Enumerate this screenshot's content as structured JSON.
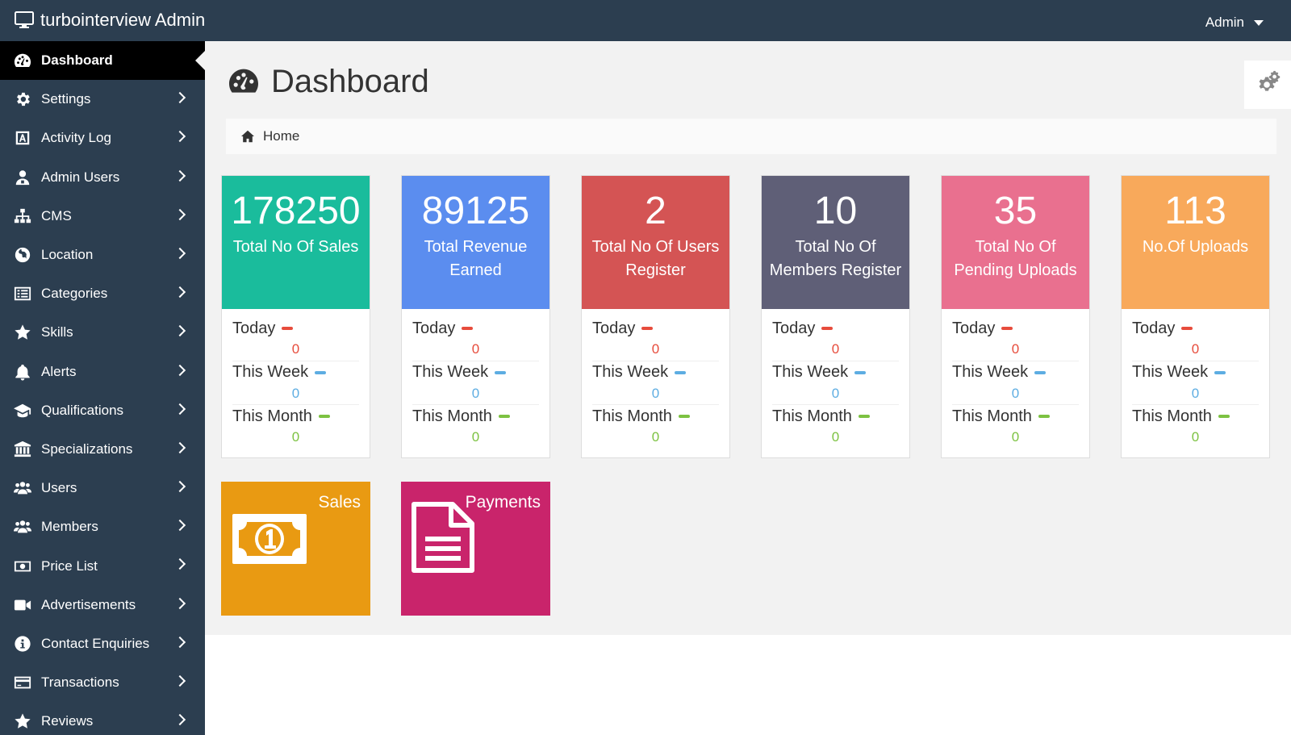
{
  "app": {
    "brand": "turbointerview Admin",
    "user": "Admin"
  },
  "sidebar": {
    "items": [
      {
        "label": "Dashboard",
        "icon": "dashboard-icon",
        "active": true
      },
      {
        "label": "Settings",
        "icon": "gear-icon"
      },
      {
        "label": "Activity Log",
        "icon": "activity-log-icon"
      },
      {
        "label": "Admin Users",
        "icon": "admin-user-icon"
      },
      {
        "label": "CMS",
        "icon": "sitemap-icon"
      },
      {
        "label": "Location",
        "icon": "globe-icon"
      },
      {
        "label": "Categories",
        "icon": "list-icon"
      },
      {
        "label": "Skills",
        "icon": "star-icon"
      },
      {
        "label": "Alerts",
        "icon": "bell-icon"
      },
      {
        "label": "Qualifications",
        "icon": "graduation-cap-icon"
      },
      {
        "label": "Specializations",
        "icon": "bank-icon"
      },
      {
        "label": "Users",
        "icon": "users-icon"
      },
      {
        "label": "Members",
        "icon": "users-icon"
      },
      {
        "label": "Price List",
        "icon": "money-icon"
      },
      {
        "label": "Advertisements",
        "icon": "video-camera-icon"
      },
      {
        "label": "Contact Enquiries",
        "icon": "info-icon"
      },
      {
        "label": "Transactions",
        "icon": "credit-card-icon"
      },
      {
        "label": "Reviews",
        "icon": "star-icon"
      }
    ]
  },
  "page": {
    "title": "Dashboard",
    "breadcrumb": "Home"
  },
  "stats": {
    "row_labels": {
      "today": "Today",
      "week": "This Week",
      "month": "This Month"
    },
    "cards": [
      {
        "number": "178250",
        "label": "Total No Of Sales",
        "color": "#1abc9c",
        "today": "0",
        "week": "0",
        "month": "0"
      },
      {
        "number": "89125",
        "label": "Total Revenue Earned",
        "color": "#5b8def",
        "today": "0",
        "week": "0",
        "month": "0"
      },
      {
        "number": "2",
        "label": "Total No Of Users Register",
        "color": "#d45454",
        "today": "0",
        "week": "0",
        "month": "0"
      },
      {
        "number": "10",
        "label": "Total No Of Members Register",
        "color": "#5f5f77",
        "today": "0",
        "week": "0",
        "month": "0"
      },
      {
        "number": "35",
        "label": "Total No Of Pending Uploads",
        "color": "#e9708f",
        "today": "0",
        "week": "0",
        "month": "0"
      },
      {
        "number": "113",
        "label": "No.Of Uploads",
        "color": "#f8a95b",
        "today": "0",
        "week": "0",
        "month": "0"
      }
    ]
  },
  "tiles": [
    {
      "label": "Sales",
      "icon": "money-bill-icon",
      "color": "#e99a12"
    },
    {
      "label": "Payments",
      "icon": "document-icon",
      "color": "#c9246b"
    }
  ],
  "colors": {
    "sidebar": "#2c3e50",
    "active": "#000000",
    "content_bg": "#f2f2f2",
    "today": "#e74c3c",
    "week": "#5dade2",
    "month": "#7dc242"
  }
}
